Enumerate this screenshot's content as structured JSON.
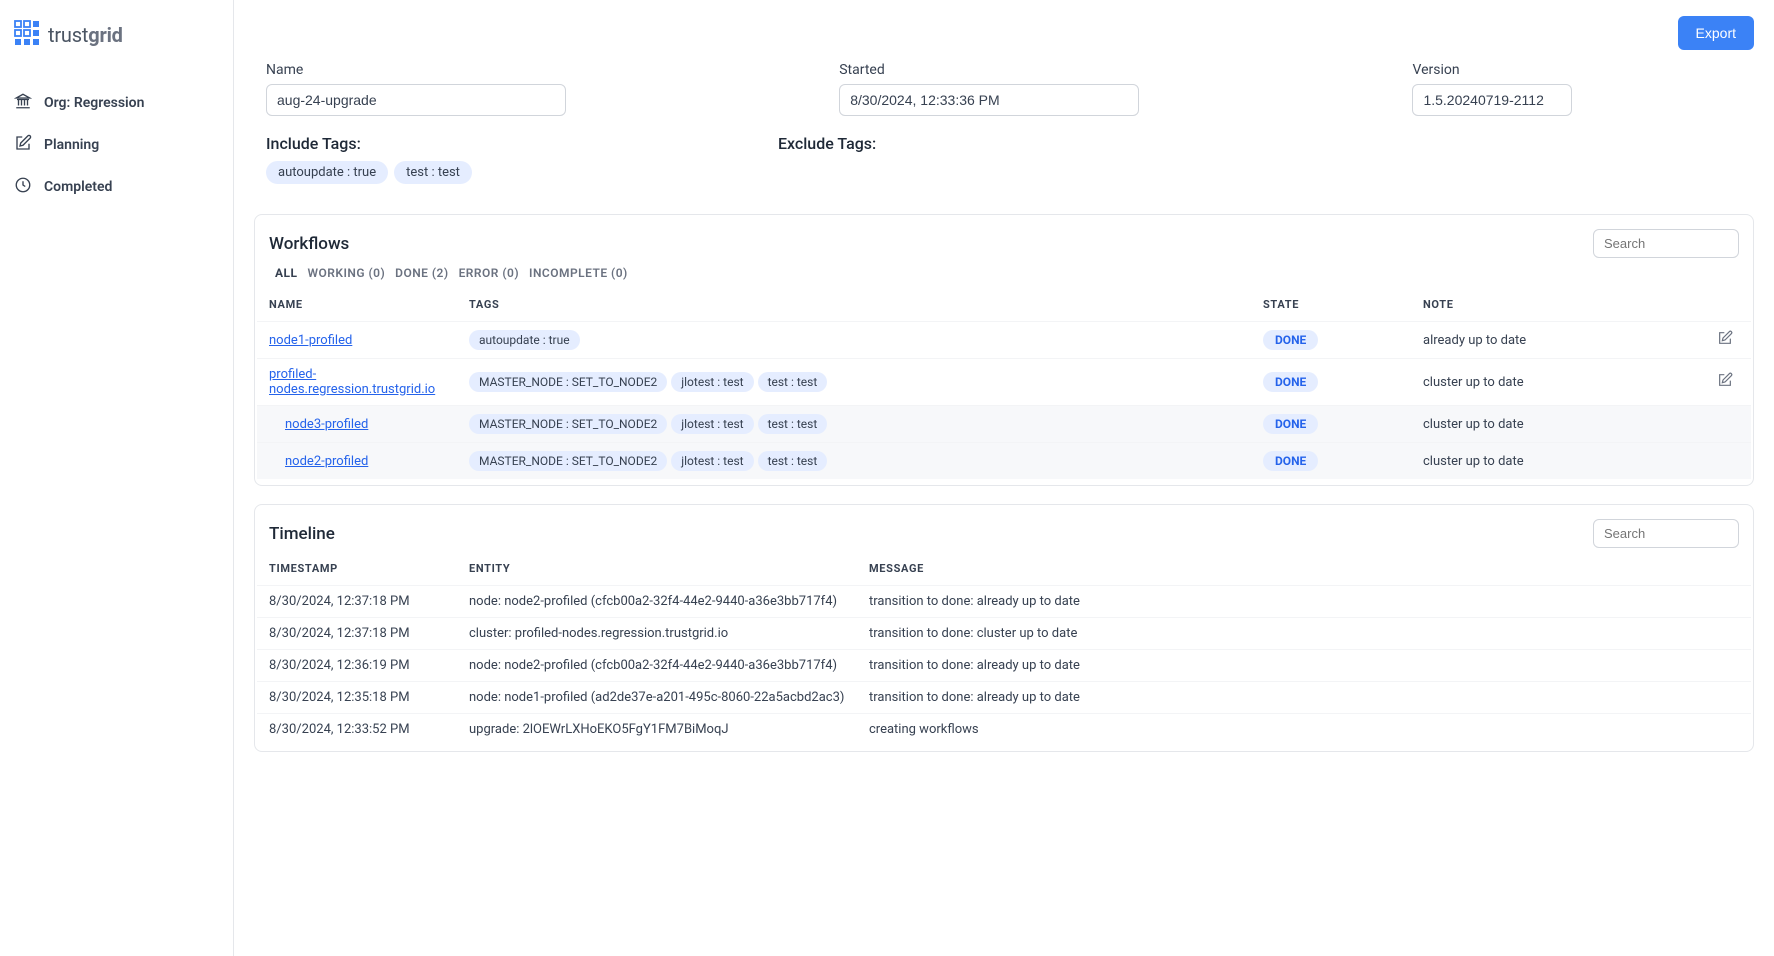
{
  "brand": {
    "t1": "trust",
    "t2": "grid"
  },
  "sidebar": {
    "items": [
      {
        "label": "Org: Regression",
        "icon": "bank"
      },
      {
        "label": "Planning",
        "icon": "edit"
      },
      {
        "label": "Completed",
        "icon": "clock"
      }
    ]
  },
  "export_label": "Export",
  "details": {
    "name_label": "Name",
    "name_value": "aug-24-upgrade",
    "started_label": "Started",
    "started_value": "8/30/2024, 12:33:36 PM",
    "version_label": "Version",
    "version_value": "1.5.20240719-2112"
  },
  "include_tags_label": "Include Tags:",
  "include_tags": [
    "autoupdate : true",
    "test : test"
  ],
  "exclude_tags_label": "Exclude Tags:",
  "workflows": {
    "title": "Workflows",
    "search_placeholder": "Search",
    "tabs": [
      {
        "label": "ALL",
        "active": true
      },
      {
        "label": "WORKING (0)"
      },
      {
        "label": "DONE (2)"
      },
      {
        "label": "ERROR (0)"
      },
      {
        "label": "INCOMPLETE (0)"
      }
    ],
    "headers": {
      "name": "NAME",
      "tags": "TAGS",
      "state": "STATE",
      "note": "NOTE"
    },
    "rows": [
      {
        "name": "node1-profiled",
        "tags": [
          "autoupdate : true"
        ],
        "state": "DONE",
        "note": "already up to date",
        "editable": true,
        "indented": false
      },
      {
        "name": "profiled-nodes.regression.trustgrid.io",
        "tags": [
          "MASTER_NODE : SET_TO_NODE2",
          "jlotest : test",
          "test : test"
        ],
        "state": "DONE",
        "note": "cluster up to date",
        "editable": true,
        "indented": false
      },
      {
        "name": "node3-profiled",
        "tags": [
          "MASTER_NODE : SET_TO_NODE2",
          "jlotest : test",
          "test : test"
        ],
        "state": "DONE",
        "note": "cluster up to date",
        "editable": false,
        "indented": true
      },
      {
        "name": "node2-profiled",
        "tags": [
          "MASTER_NODE : SET_TO_NODE2",
          "jlotest : test",
          "test : test"
        ],
        "state": "DONE",
        "note": "cluster up to date",
        "editable": false,
        "indented": true
      }
    ]
  },
  "timeline": {
    "title": "Timeline",
    "search_placeholder": "Search",
    "headers": {
      "ts": "TIMESTAMP",
      "entity": "ENTITY",
      "msg": "MESSAGE"
    },
    "rows": [
      {
        "ts": "8/30/2024, 12:37:18 PM",
        "entity": "node: node2-profiled (cfcb00a2-32f4-44e2-9440-a36e3bb717f4)",
        "msg": "transition to done: already up to date"
      },
      {
        "ts": "8/30/2024, 12:37:18 PM",
        "entity": "cluster: profiled-nodes.regression.trustgrid.io",
        "msg": "transition to done: cluster up to date"
      },
      {
        "ts": "8/30/2024, 12:36:19 PM",
        "entity": "node: node2-profiled (cfcb00a2-32f4-44e2-9440-a36e3bb717f4)",
        "msg": "transition to done: already up to date"
      },
      {
        "ts": "8/30/2024, 12:35:18 PM",
        "entity": "node: node1-profiled (ad2de37e-a201-495c-8060-22a5acbd2ac3)",
        "msg": "transition to done: already up to date"
      },
      {
        "ts": "8/30/2024, 12:33:52 PM",
        "entity": "upgrade: 2lOEWrLXHoEKO5FgY1FM7BiMoqJ",
        "msg": "creating workflows"
      }
    ]
  }
}
